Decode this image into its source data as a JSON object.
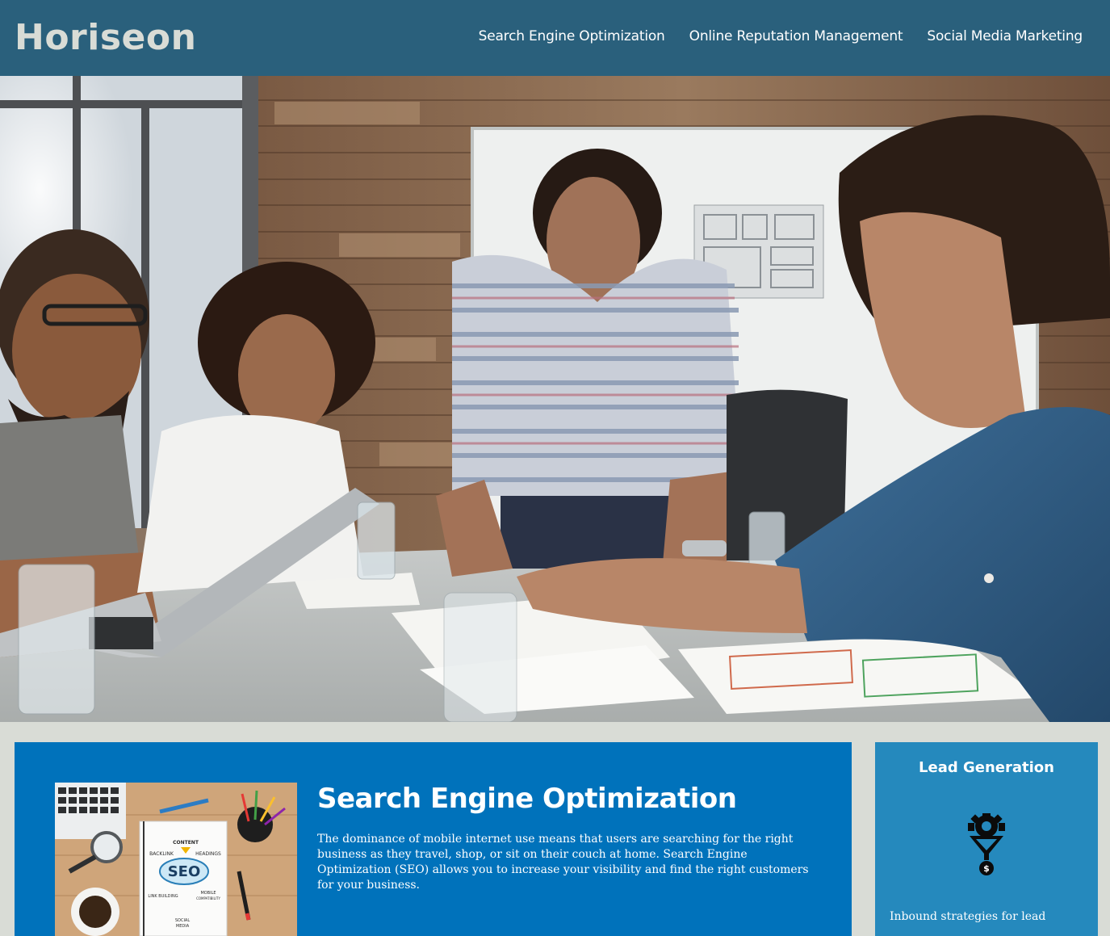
{
  "header": {
    "logo": "Horiseon",
    "nav": [
      {
        "label": "Search Engine Optimization"
      },
      {
        "label": "Online Reputation Management"
      },
      {
        "label": "Social Media Marketing"
      }
    ]
  },
  "seo": {
    "image_words": {
      "seo": "SEO",
      "content": "CONTENT",
      "backlink": "BACKLINK",
      "headings": "HEADINGS",
      "link_building": "LINK BUILDING",
      "mobile": "MOBILE",
      "compat": "COMPATIBILITY",
      "social": "SOCIAL",
      "media": "MEDIA"
    },
    "title": "Search Engine Optimization",
    "text": "The dominance of mobile internet use means that users are searching for the right business as they travel, shop, or sit on their couch at home. Search Engine Optimization (SEO) allows you to increase your visibility and find the right customers for your business."
  },
  "aside": {
    "title": "Lead Generation",
    "icon": "funnel-gear-dollar-icon",
    "teaser": "Inbound strategies for lead"
  },
  "colors": {
    "header_bg": "#2a607c",
    "content_bg": "#0072bb",
    "aside_bg": "#2589bd",
    "page_bg": "#d9dcd6"
  }
}
